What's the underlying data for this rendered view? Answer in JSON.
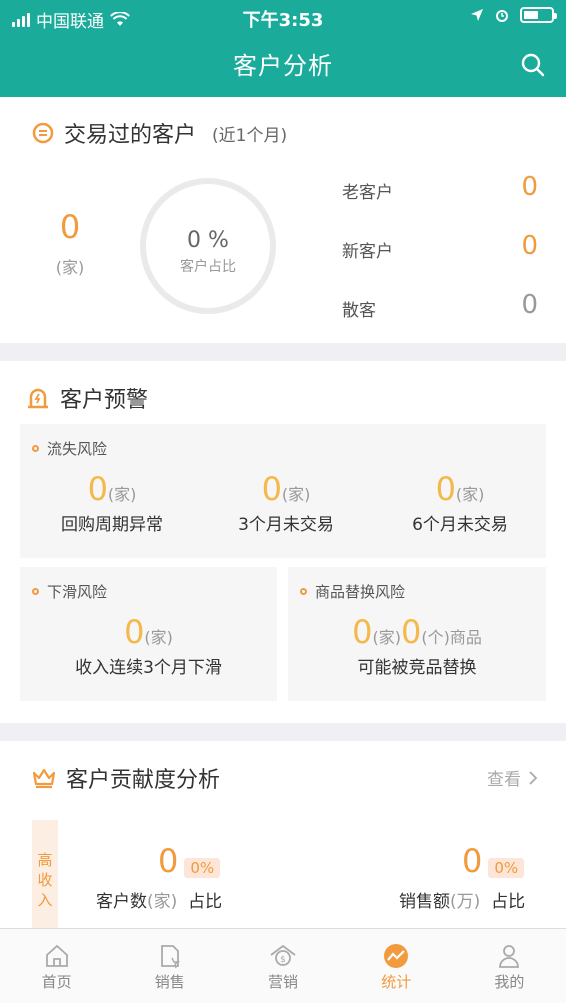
{
  "status_bar": {
    "carrier": "中国联通",
    "time": "下午3:53"
  },
  "header": {
    "title": "客户分析"
  },
  "traded_customers": {
    "title": "交易过的客户",
    "period": "(近1个月)",
    "total": "0",
    "unit": "(家)",
    "ring_percent": "0 %",
    "ring_label": "客户占比",
    "rows": [
      {
        "label": "老客户",
        "value": "0",
        "color": "#f19a3e"
      },
      {
        "label": "新客户",
        "value": "0",
        "color": "#f19a3e"
      },
      {
        "label": "散客",
        "value": "0",
        "color": "#999999"
      }
    ]
  },
  "warning": {
    "title": "客户预警",
    "churn": {
      "title": "流失风险",
      "items": [
        {
          "num": "0",
          "unit": "(家)",
          "desc": "回购周期异常"
        },
        {
          "num": "0",
          "unit": "(家)",
          "desc": "3个月未交易"
        },
        {
          "num": "0",
          "unit": "(家)",
          "desc": "6个月未交易"
        }
      ]
    },
    "decline": {
      "title": "下滑风险",
      "num": "0",
      "unit": "(家)",
      "desc": "收入连续3个月下滑"
    },
    "replace": {
      "title": "商品替换风险",
      "num1": "0",
      "unit1": "(家)",
      "num2": "0",
      "unit2": "(个)商品",
      "desc": "可能被竞品替换"
    }
  },
  "contribution": {
    "title": "客户贡献度分析",
    "view_label": "查看",
    "tag": "高收入",
    "left": {
      "num": "0",
      "pct": "0%",
      "label": "客户数",
      "unit": "(家)",
      "suffix": "占比"
    },
    "right": {
      "num": "0",
      "pct": "0%",
      "label": "销售额",
      "unit": "(万)",
      "suffix": "占比"
    }
  },
  "tabs": [
    {
      "label": "首页",
      "icon": "home-icon"
    },
    {
      "label": "销售",
      "icon": "sales-doc-icon"
    },
    {
      "label": "营销",
      "icon": "marketing-icon"
    },
    {
      "label": "统计",
      "icon": "stats-icon",
      "active": true
    },
    {
      "label": "我的",
      "icon": "profile-icon"
    }
  ],
  "colors": {
    "brand": "#1aab9b",
    "accent": "#f19a3e"
  }
}
